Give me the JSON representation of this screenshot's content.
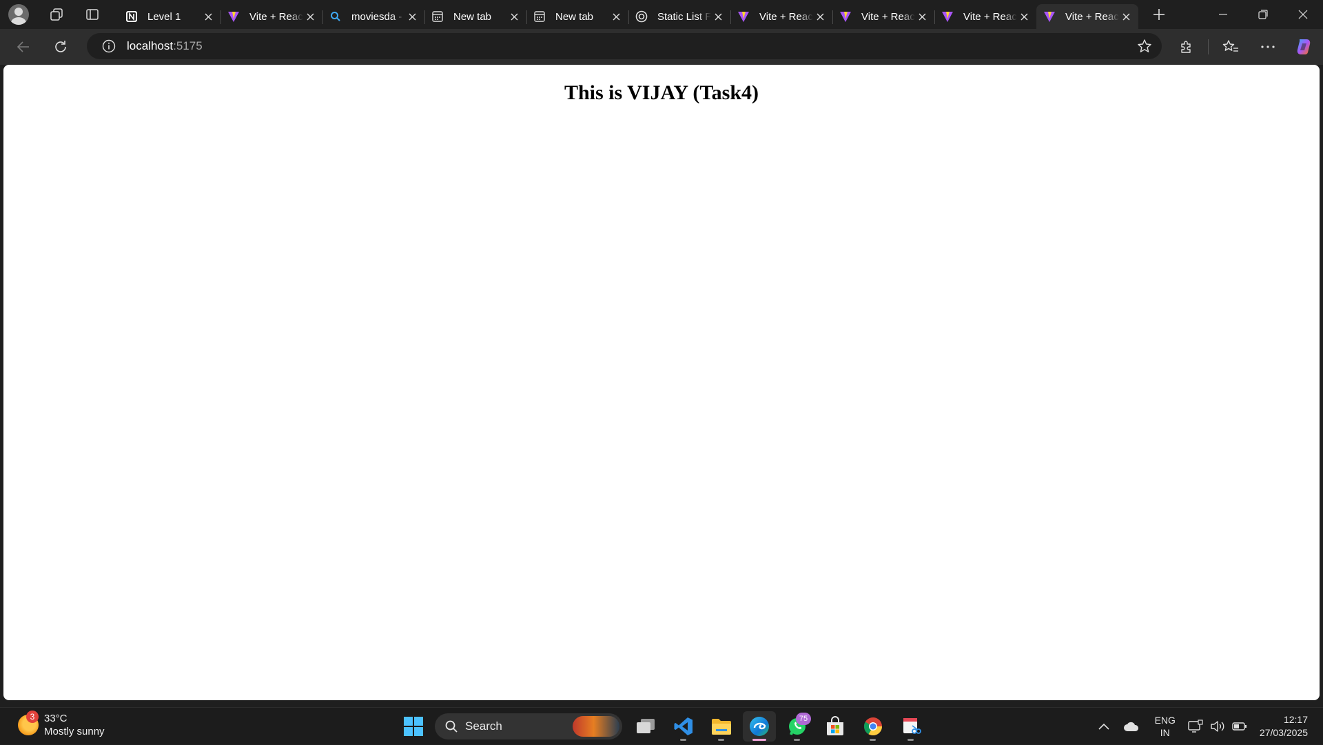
{
  "browser": {
    "tabs": [
      {
        "title": "Level 1",
        "icon": "notion-icon",
        "active": false
      },
      {
        "title": "Vite + React",
        "icon": "vite-icon",
        "active": false
      },
      {
        "title": "moviesda -",
        "icon": "search-icon",
        "active": false
      },
      {
        "title": "New tab",
        "icon": "newtab-icon",
        "active": false
      },
      {
        "title": "New tab",
        "icon": "newtab-icon",
        "active": false
      },
      {
        "title": "Static List F",
        "icon": "chatgpt-icon",
        "active": false
      },
      {
        "title": "Vite + React",
        "icon": "vite-icon",
        "active": false
      },
      {
        "title": "Vite + React",
        "icon": "vite-icon",
        "active": false
      },
      {
        "title": "Vite + React",
        "icon": "vite-icon",
        "active": false
      },
      {
        "title": "Vite + React",
        "icon": "vite-icon",
        "active": true
      }
    ],
    "address": {
      "host": "localhost",
      "port": ":5175"
    }
  },
  "page": {
    "heading": "This is VIJAY (Task4)"
  },
  "taskbar": {
    "weather": {
      "badge": "3",
      "temp": "33°C",
      "condition": "Mostly sunny"
    },
    "search_label": "Search",
    "whatsapp_badge": "75",
    "language": {
      "line1": "ENG",
      "line2": "IN"
    },
    "clock": {
      "time": "12:17",
      "date": "27/03/2025"
    }
  },
  "colors": {
    "chrome_dark": "#1f1f1f",
    "toolbar": "#2e2e2e",
    "page_bg": "#ffffff",
    "vite_purple": "#a855f7",
    "vite_yellow": "#ffd62e"
  }
}
